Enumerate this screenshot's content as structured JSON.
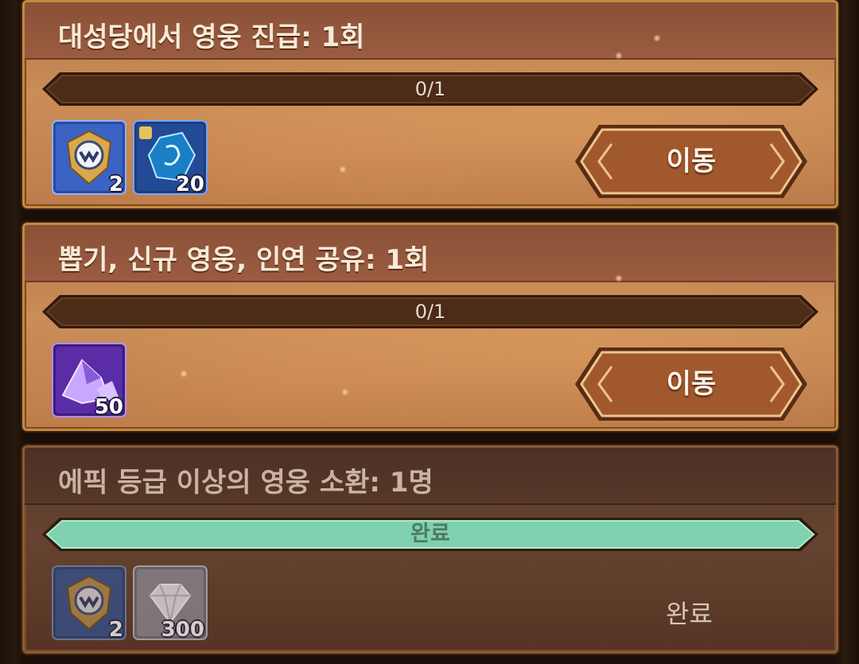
{
  "quests": [
    {
      "title": "대성당에서 영웅 진급: 1회",
      "progress_text": "0/1",
      "progress_fraction": 0,
      "rewards": [
        {
          "icon": "guild-emblem-icon",
          "count": "2"
        },
        {
          "icon": "blue-crystal-shard-icon",
          "count": "20"
        }
      ],
      "action_label": "이동",
      "completed": false
    },
    {
      "title": "뽑기, 신규 영웅, 인연 공유: 1회",
      "progress_text": "0/1",
      "progress_fraction": 0,
      "rewards": [
        {
          "icon": "purple-crystal-icon",
          "count": "50"
        }
      ],
      "action_label": "이동",
      "completed": false
    },
    {
      "title": "에픽 등급 이상의 영웅 소환: 1명",
      "progress_text": "완료",
      "progress_fraction": 1,
      "rewards": [
        {
          "icon": "guild-emblem-icon",
          "count": "2"
        },
        {
          "icon": "diamond-icon",
          "count": "300"
        }
      ],
      "action_label": "완료",
      "completed": true
    }
  ],
  "colors": {
    "progress_empty": "#4a2c17",
    "progress_full": "#7fd1b0",
    "button": "#a1582d"
  }
}
